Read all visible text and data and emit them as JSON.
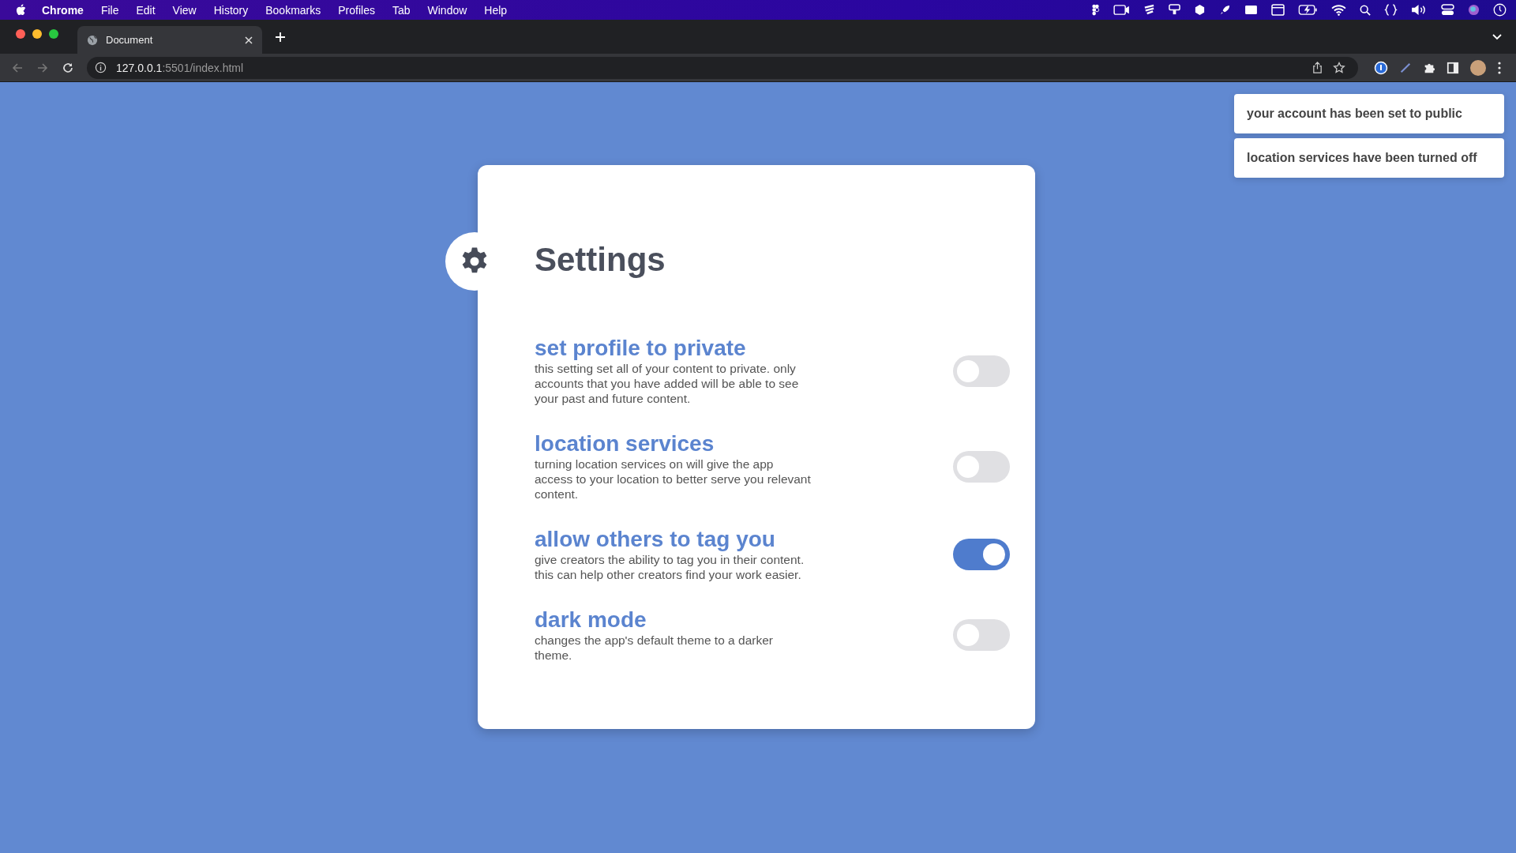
{
  "menu_bar": {
    "app": "Chrome",
    "items": [
      "File",
      "Edit",
      "View",
      "History",
      "Bookmarks",
      "Profiles",
      "Tab",
      "Window",
      "Help"
    ]
  },
  "browser": {
    "tab": {
      "title": "Document"
    },
    "address": {
      "host": "127.0.0.1",
      "path": ":5501/index.html"
    }
  },
  "toasts": [
    {
      "text": "your account has been set to public"
    },
    {
      "text": "location services have been turned off"
    }
  ],
  "settings": {
    "title": "Settings",
    "items": [
      {
        "title": "set profile to private",
        "description": "this setting set all of your content to private. only accounts that you have added will be able to see your past and future content.",
        "on": false
      },
      {
        "title": "location services",
        "description": "turning location services on will give the app access to your location to better serve you relevant content.",
        "on": false
      },
      {
        "title": "allow others to tag you",
        "description": "give creators the ability to tag you in their content. this can help other creators find your work easier.",
        "on": true
      },
      {
        "title": "dark mode",
        "description": "changes the app's default theme to a darker theme.",
        "on": false
      }
    ]
  }
}
